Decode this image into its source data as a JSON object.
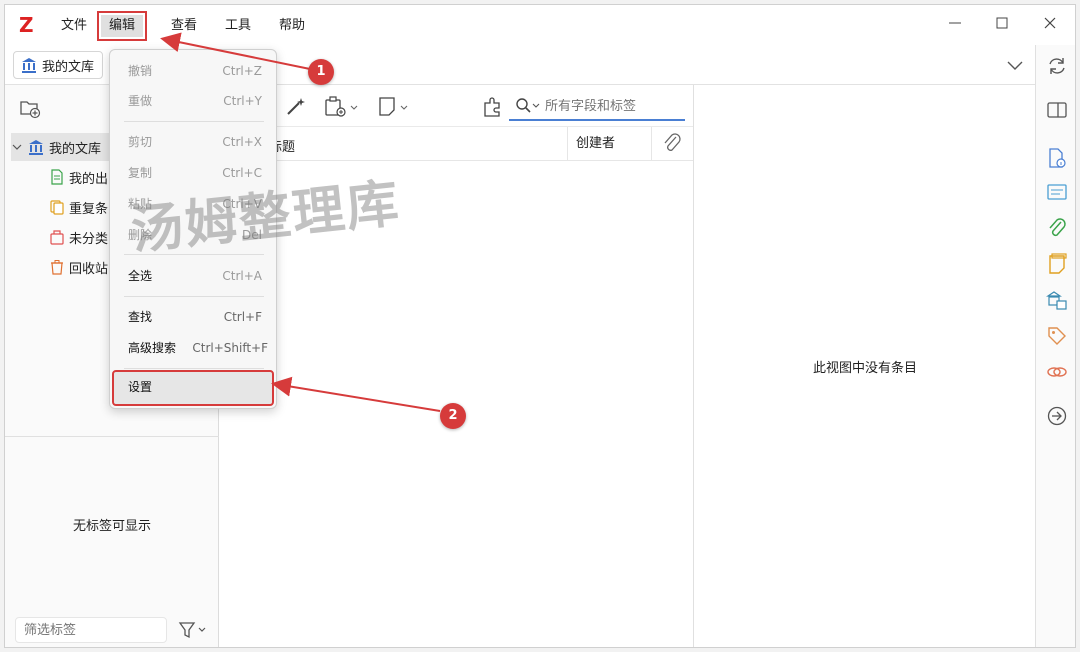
{
  "app": {
    "logo_letter": "Z",
    "accent_color": "#d22222"
  },
  "menubar": {
    "items": [
      {
        "label": "文件"
      },
      {
        "label": "编辑"
      },
      {
        "label": "查看"
      },
      {
        "label": "工具"
      },
      {
        "label": "帮助"
      }
    ]
  },
  "library_tab": {
    "label": "我的文库"
  },
  "collections": {
    "items": [
      {
        "label": "我的文库"
      },
      {
        "label": "我的出"
      },
      {
        "label": "重复条"
      },
      {
        "label": "未分类"
      },
      {
        "label": "回收站"
      }
    ]
  },
  "tags": {
    "empty_text": "无标签可显示",
    "filter_placeholder": "筛选标签"
  },
  "search": {
    "placeholder": "所有字段和标签"
  },
  "columns": {
    "title": "标题",
    "creator": "创建者"
  },
  "item_pane": {
    "empty_text": "此视图中没有条目"
  },
  "edit_menu": {
    "items": [
      {
        "label": "撤销",
        "shortcut": "Ctrl+Z"
      },
      {
        "label": "重做",
        "shortcut": "Ctrl+Y"
      },
      {
        "label": "剪切",
        "shortcut": "Ctrl+X"
      },
      {
        "label": "复制",
        "shortcut": "Ctrl+C"
      },
      {
        "label": "粘贴",
        "shortcut": "Ctrl+V"
      },
      {
        "label": "删除",
        "shortcut": "Del"
      },
      {
        "label": "全选",
        "shortcut": "Ctrl+A"
      },
      {
        "label": "查找",
        "shortcut": "Ctrl+F"
      },
      {
        "label": "高级搜索",
        "shortcut": "Ctrl+Shift+F"
      },
      {
        "label": "设置",
        "shortcut": ""
      }
    ]
  },
  "watermark": "汤姆整理库",
  "annotations": {
    "step1": "1",
    "step2": "2",
    "color": "#d63b3b"
  }
}
